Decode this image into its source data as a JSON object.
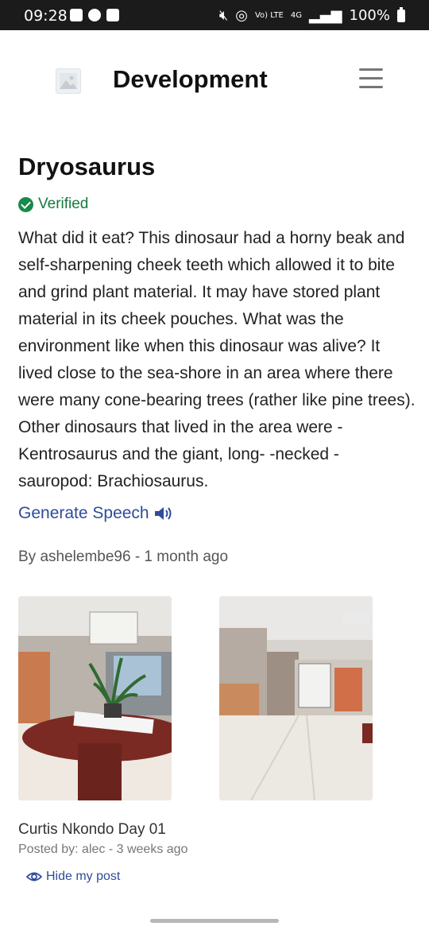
{
  "status_bar": {
    "time": "09:28",
    "signal_text": "Vo) LTE",
    "network": "4G",
    "battery": "100%"
  },
  "header": {
    "title": "Development",
    "logo_icon": "image-placeholder-icon",
    "menu_icon": "hamburger-menu-icon"
  },
  "post": {
    "title": "Dryosaurus",
    "verified_label": "Verified",
    "body": "What did it eat? This dinosaur had a horny beak and self-sharpening cheek teeth which allowed it to bite and grind plant material. It may have stored plant material in its cheek pouches. What was the environment like when this dinosaur was alive? It lived close to the sea-shore in an area where there were many cone-bearing trees (rather like pine trees). Other dinosaurs that lived in the area were - Kentrosaurus and the giant, long- -necked - sauropod: Brachiosaurus.",
    "speech_label": "Generate Speech",
    "byline": "By ashelembe96 - 1 month ago"
  },
  "photos": [
    {
      "alt": "Reception area with plant and round table"
    },
    {
      "alt": "Hallway with display cabinets"
    }
  ],
  "gallery": {
    "caption": "Curtis Nkondo Day 01",
    "posted": "Posted by: alec - 3 weeks ago",
    "hide_label": "Hide my post"
  },
  "colors": {
    "link": "#2f4c9a",
    "verified": "#147a3f",
    "status_bar": "#1b1b1b"
  }
}
